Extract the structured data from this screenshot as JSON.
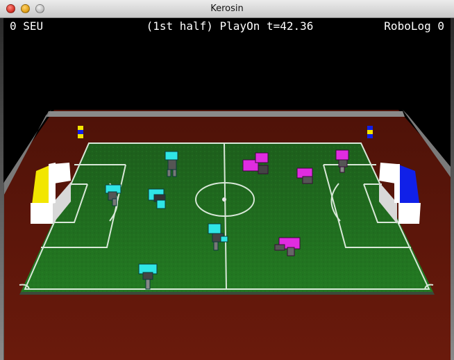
{
  "window": {
    "title": "Kerosin"
  },
  "hud": {
    "left_score": "0 SEU",
    "status": "(1st half) PlayOn t=42.36",
    "right_score": "RoboLog 0"
  },
  "field": {
    "pitch_color": "#1f6b1e",
    "border_color": "#5c1509",
    "line_color": "#d8e8d8",
    "goal_left_color": "#f2e600",
    "goal_right_color": "#1020e8"
  },
  "teams": {
    "left_color": "#2fe6e6",
    "right_color": "#e02ce0"
  }
}
